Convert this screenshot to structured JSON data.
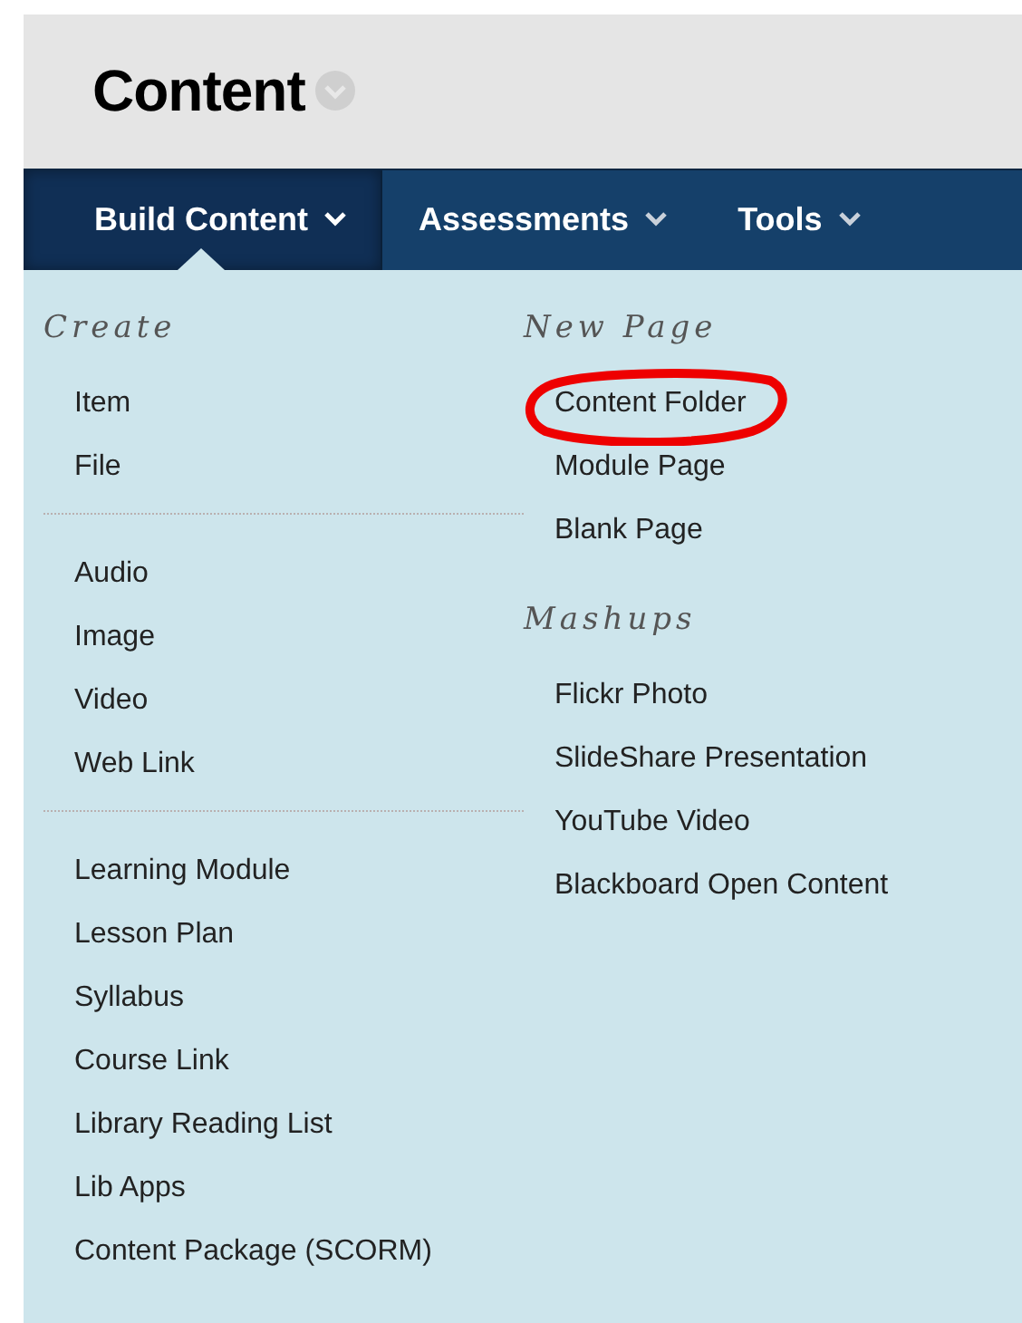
{
  "page": {
    "title": "Content"
  },
  "nav": [
    {
      "label": "Build Content",
      "selected": true
    },
    {
      "label": "Assessments",
      "selected": false
    },
    {
      "label": "Tools",
      "selected": false
    }
  ],
  "menu": {
    "columns": [
      {
        "sections": [
          {
            "heading": "Create",
            "groups": [
              [
                {
                  "label": "Item",
                  "circled": false
                },
                {
                  "label": "File",
                  "circled": false
                }
              ],
              [
                {
                  "label": "Audio",
                  "circled": false
                },
                {
                  "label": "Image",
                  "circled": false
                },
                {
                  "label": "Video",
                  "circled": false
                },
                {
                  "label": "Web Link",
                  "circled": false
                }
              ],
              [
                {
                  "label": "Learning Module",
                  "circled": false
                },
                {
                  "label": "Lesson Plan",
                  "circled": false
                },
                {
                  "label": "Syllabus",
                  "circled": false
                },
                {
                  "label": "Course Link",
                  "circled": false
                },
                {
                  "label": "Library Reading List",
                  "circled": false
                },
                {
                  "label": "Lib Apps",
                  "circled": false
                },
                {
                  "label": "Content Package (SCORM)",
                  "circled": false
                }
              ]
            ]
          }
        ]
      },
      {
        "sections": [
          {
            "heading": "New Page",
            "groups": [
              [
                {
                  "label": "Content Folder",
                  "circled": true
                },
                {
                  "label": "Module Page",
                  "circled": false
                },
                {
                  "label": "Blank Page",
                  "circled": false
                }
              ]
            ]
          },
          {
            "heading": "Mashups",
            "groups": [
              [
                {
                  "label": "Flickr Photo",
                  "circled": false
                },
                {
                  "label": "SlideShare Presentation",
                  "circled": false
                },
                {
                  "label": "YouTube Video",
                  "circled": false
                },
                {
                  "label": "Blackboard Open Content",
                  "circled": false
                }
              ]
            ]
          }
        ]
      }
    ]
  }
}
